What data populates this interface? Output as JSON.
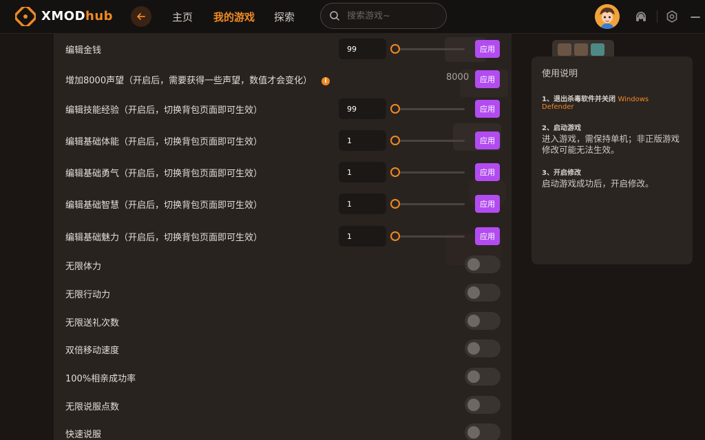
{
  "app": {
    "brand_main": "XMOD",
    "brand_accent": "hub",
    "accent_color": "#f08a24",
    "apply_color": "#b24cf0"
  },
  "nav": {
    "home": "主页",
    "my_games": "我的游戏",
    "explore": "探索",
    "active": "my_games"
  },
  "search": {
    "placeholder": "搜索游戏~"
  },
  "icons": {
    "logo": "xmod-logo-icon",
    "back": "back-arrow-icon",
    "search": "search-icon",
    "support": "headset-icon",
    "settings": "gear-icon",
    "minimize": "minimize-icon"
  },
  "mods": [
    {
      "label": "编辑金钱",
      "kind": "numeric",
      "value": "99",
      "slider_fraction": 0.0,
      "button": "应用"
    },
    {
      "label": "增加8000声望（开启后，需要获得一些声望，数值才会变化）",
      "kind": "fixed",
      "value": "8000",
      "button": "应用",
      "has_info": true
    },
    {
      "label": "编辑技能经验（开启后，切换背包页面即可生效）",
      "kind": "numeric",
      "value": "99",
      "slider_fraction": 0.0,
      "button": "应用"
    },
    {
      "label": "编辑基础体能（开启后，切换背包页面即可生效）",
      "kind": "numeric",
      "value": "1",
      "slider_fraction": 0.0,
      "button": "应用"
    },
    {
      "label": "编辑基础勇气（开启后，切换背包页面即可生效）",
      "kind": "numeric",
      "value": "1",
      "slider_fraction": 0.0,
      "button": "应用"
    },
    {
      "label": "编辑基础智慧（开启后，切换背包页面即可生效）",
      "kind": "numeric",
      "value": "1",
      "slider_fraction": 0.0,
      "button": "应用"
    },
    {
      "label": "编辑基础魅力（开启后，切换背包页面即可生效）",
      "kind": "numeric",
      "value": "1",
      "slider_fraction": 0.0,
      "button": "应用"
    },
    {
      "label": "无限体力",
      "kind": "toggle",
      "on": false
    },
    {
      "label": "无限行动力",
      "kind": "toggle",
      "on": false
    },
    {
      "label": "无限送礼次数",
      "kind": "toggle",
      "on": false
    },
    {
      "label": "双倍移动速度",
      "kind": "toggle",
      "on": false
    },
    {
      "label": "100%相亲成功率",
      "kind": "toggle",
      "on": false
    },
    {
      "label": "无限说服点数",
      "kind": "toggle",
      "on": false
    },
    {
      "label": "快速说服",
      "kind": "toggle",
      "on": false
    }
  ],
  "info_icon": "i",
  "help": {
    "title": "使用说明",
    "steps": [
      {
        "title": "1、退出杀毒软件并关闭",
        "highlight": "Windows Defender",
        "desc": ""
      },
      {
        "title": "2、启动游戏",
        "highlight": "",
        "desc": "进入游戏，需保持单机；非正版游戏修改可能无法生效。"
      },
      {
        "title": "3、开启修改",
        "highlight": "",
        "desc": "启动游戏成功后，开启修改。"
      }
    ]
  }
}
